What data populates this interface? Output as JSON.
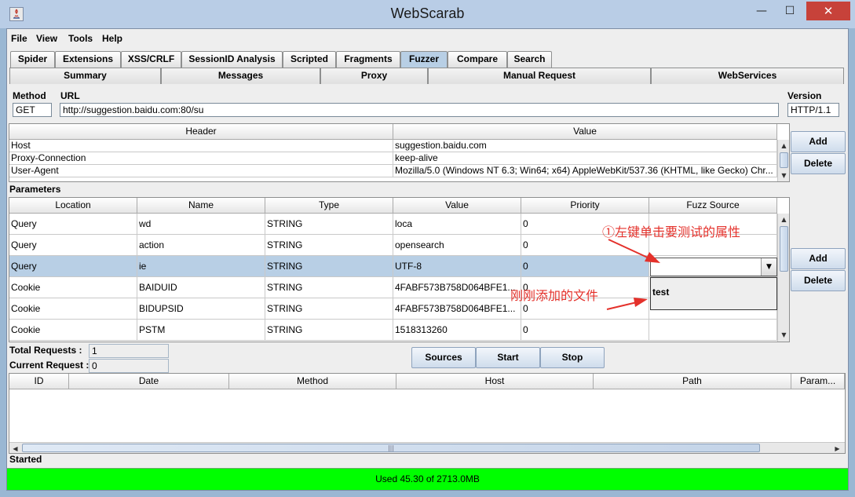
{
  "window": {
    "title": "WebScarab",
    "controls": {
      "minimize": "—",
      "maximize": "☐",
      "close": "✕"
    }
  },
  "menu": [
    "File",
    "View",
    "Tools",
    "Help"
  ],
  "tabs_top": [
    "Spider",
    "Extensions",
    "XSS/CRLF",
    "SessionID Analysis",
    "Scripted",
    "Fragments",
    "Fuzzer",
    "Compare",
    "Search"
  ],
  "active_tab": "Fuzzer",
  "tabs_bottom": [
    "Summary",
    "Messages",
    "Proxy",
    "Manual Request",
    "WebServices"
  ],
  "request": {
    "method_label": "Method",
    "url_label": "URL",
    "version_label": "Version",
    "method": "GET",
    "url": "http://suggestion.baidu.com:80/su",
    "version": "HTTP/1.1"
  },
  "headers_table": {
    "columns": [
      "Header",
      "Value"
    ],
    "rows": [
      [
        "Host",
        "suggestion.baidu.com"
      ],
      [
        "Proxy-Connection",
        "keep-alive"
      ],
      [
        "User-Agent",
        "Mozilla/5.0 (Windows NT 6.3; Win64; x64) AppleWebKit/537.36 (KHTML, like Gecko) Chr..."
      ]
    ],
    "add_label": "Add",
    "delete_label": "Delete"
  },
  "parameters": {
    "section_label": "Parameters",
    "columns": [
      "Location",
      "Name",
      "Type",
      "Value",
      "Priority",
      "Fuzz Source"
    ],
    "rows": [
      [
        "Query",
        "wd",
        "STRING",
        "loca",
        "0",
        ""
      ],
      [
        "Query",
        "action",
        "STRING",
        "opensearch",
        "0",
        ""
      ],
      [
        "Query",
        "ie",
        "STRING",
        "UTF-8",
        "0",
        ""
      ],
      [
        "Cookie",
        "BAIDUID",
        "STRING",
        "4FABF573B758D064BFE1...",
        "0",
        ""
      ],
      [
        "Cookie",
        "BIDUPSID",
        "STRING",
        "4FABF573B758D064BFE1...",
        "0",
        ""
      ],
      [
        "Cookie",
        "PSTM",
        "STRING",
        "1518313260",
        "0",
        ""
      ]
    ],
    "selected_row": 2,
    "dropdown_option": "test",
    "add_label": "Add",
    "delete_label": "Delete"
  },
  "annotations": {
    "click_hint": "①左键单击要测试的属性",
    "file_hint": "刚刚添加的文件",
    "color": "#e4312b"
  },
  "counters": {
    "total_label": "Total Requests :",
    "total_value": "1",
    "current_label": "Current Request :",
    "current_value": "0"
  },
  "actions": {
    "sources": "Sources",
    "start": "Start",
    "stop": "Stop"
  },
  "results_table": {
    "columns": [
      "ID",
      "Date",
      "Method",
      "Host",
      "Path",
      "Param..."
    ]
  },
  "status": {
    "text": "Started",
    "memory": "Used 45.30 of 2713.0MB"
  },
  "colors": {
    "selection": "#b8cfe5",
    "memory_bar": "#00ff00",
    "titlebar": "#b9cde6"
  }
}
